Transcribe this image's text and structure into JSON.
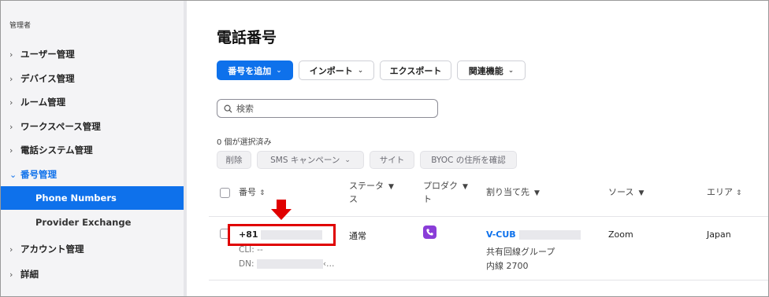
{
  "sidebar": {
    "header": "管理者",
    "items": [
      {
        "label": "ユーザー管理",
        "chevron": "›"
      },
      {
        "label": "デバイス管理",
        "chevron": "›"
      },
      {
        "label": "ルーム管理",
        "chevron": "›"
      },
      {
        "label": "ワークスペース管理",
        "chevron": "›"
      },
      {
        "label": "電話システム管理",
        "chevron": "›"
      },
      {
        "label": "番号管理",
        "chevron": "⌄"
      }
    ],
    "subitems": [
      {
        "label": "Phone Numbers"
      },
      {
        "label": "Provider Exchange"
      }
    ],
    "items_after": [
      {
        "label": "アカウント管理",
        "chevron": "›"
      },
      {
        "label": "詳細",
        "chevron": "›"
      }
    ]
  },
  "main": {
    "title": "電話番号",
    "toolbar": {
      "add_label": "番号を追加",
      "import_label": "インポート",
      "export_label": "エクスポート",
      "related_label": "関連機能"
    },
    "search": {
      "placeholder": "検索"
    },
    "selected_count": "0 個が選択済み",
    "bulk_actions": {
      "delete": "削除",
      "sms_campaign": "SMS キャンペーン",
      "site": "サイト",
      "byoc": "BYOC の住所を確認"
    },
    "table": {
      "headers": {
        "number": "番号",
        "status_1": "ステータ",
        "status_2": "ス",
        "product_1": "プロダク",
        "product_2": "ト",
        "assigned": "割り当て先",
        "source": "ソース",
        "area": "エリア"
      },
      "rows": [
        {
          "number": "+81",
          "cli": "CLI: --",
          "dn_prefix": "DN:",
          "dn_suffix": "‹…",
          "status": "通常",
          "assigned_name": "V-CUB",
          "assigned_group": "共有回線グループ",
          "assigned_ext": "内線 2700",
          "source": "Zoom",
          "area": "Japan"
        }
      ]
    }
  },
  "icons": {
    "search": "search-icon",
    "phone": "phone-icon",
    "filter": "filter-icon",
    "sort": "sort-icon"
  },
  "colors": {
    "accent": "#0e71eb",
    "highlight": "#e00000",
    "product": "#8a3dd8"
  }
}
